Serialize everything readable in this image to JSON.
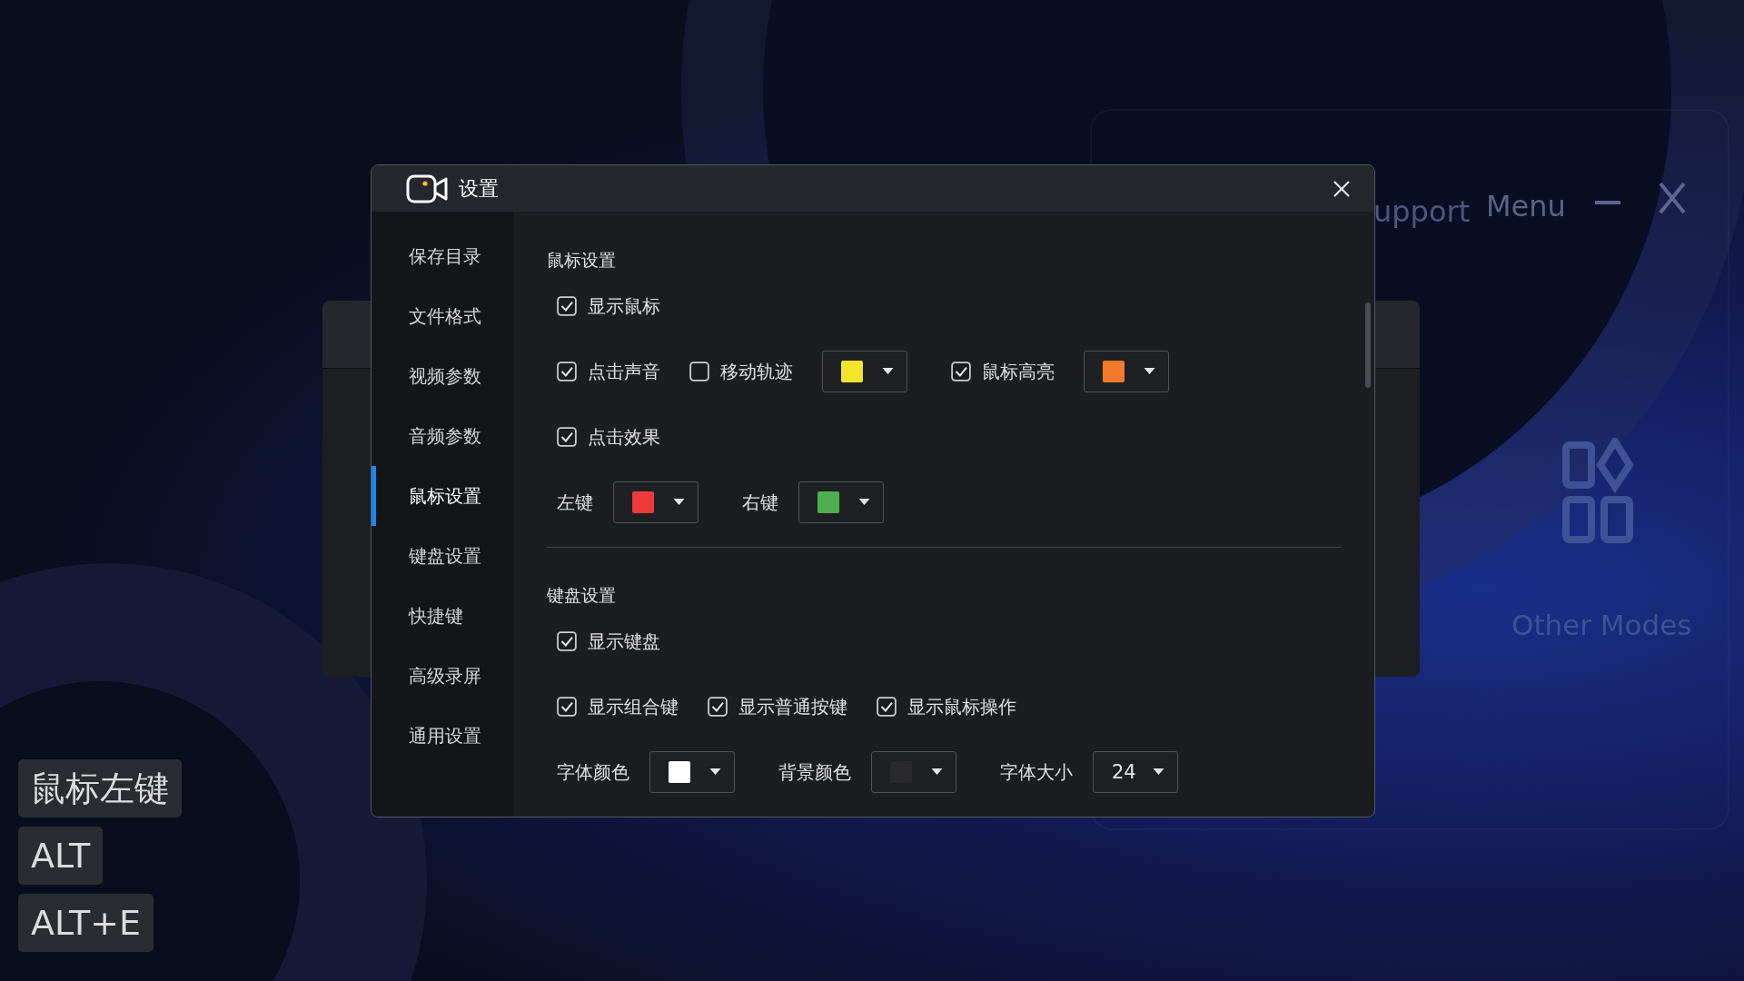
{
  "background": {
    "top_bar": {
      "support_label": "upport",
      "menu_label": "Menu"
    },
    "other_modes": {
      "label": "Other Modes"
    }
  },
  "key_overlay": [
    {
      "label": "鼠标左键"
    },
    {
      "label": "ALT"
    },
    {
      "label": "ALT+E"
    }
  ],
  "dialog": {
    "title": "设置",
    "sidebar": [
      {
        "label": "保存目录",
        "selected": false
      },
      {
        "label": "文件格式",
        "selected": false
      },
      {
        "label": "视频参数",
        "selected": false
      },
      {
        "label": "音频参数",
        "selected": false
      },
      {
        "label": "鼠标设置",
        "selected": true
      },
      {
        "label": "键盘设置",
        "selected": false
      },
      {
        "label": "快捷键",
        "selected": false
      },
      {
        "label": "高级录屏",
        "selected": false
      },
      {
        "label": "通用设置",
        "selected": false
      }
    ],
    "sections": [
      {
        "heading": "鼠标设置",
        "rows": [
          {
            "items": [
              {
                "kind": "checkbox",
                "label": "显示鼠标",
                "checked": true
              }
            ]
          },
          {
            "items": [
              {
                "kind": "checkbox",
                "label": "点击声音",
                "checked": true
              },
              {
                "kind": "checkbox",
                "label": "移动轨迹",
                "checked": false
              },
              {
                "kind": "color",
                "color": "#f2e52c"
              },
              {
                "kind": "checkbox",
                "label": "鼠标高亮",
                "checked": true
              },
              {
                "kind": "color",
                "color": "#f47a2b"
              }
            ]
          },
          {
            "items": [
              {
                "kind": "checkbox",
                "label": "点击效果",
                "checked": true
              }
            ]
          },
          {
            "items": [
              {
                "kind": "label",
                "label": "左键"
              },
              {
                "kind": "color",
                "color": "#ee3a3a"
              },
              {
                "kind": "label",
                "label": "右键"
              },
              {
                "kind": "color",
                "color": "#4caf50"
              }
            ]
          }
        ]
      },
      {
        "heading": "键盘设置",
        "rows": [
          {
            "items": [
              {
                "kind": "checkbox",
                "label": "显示键盘",
                "checked": true
              }
            ]
          },
          {
            "items": [
              {
                "kind": "checkbox",
                "label": "显示组合键",
                "checked": true
              },
              {
                "kind": "checkbox",
                "label": "显示普通按键",
                "checked": true
              },
              {
                "kind": "checkbox",
                "label": "显示鼠标操作",
                "checked": true
              }
            ]
          },
          {
            "items": [
              {
                "kind": "label",
                "label": "字体颜色"
              },
              {
                "kind": "color",
                "color": "#ffffff"
              },
              {
                "kind": "label",
                "label": "背景颜色"
              },
              {
                "kind": "color",
                "color": "#2a2a2c"
              },
              {
                "kind": "label",
                "label": "字体大小"
              },
              {
                "kind": "select",
                "value": "24"
              }
            ]
          }
        ]
      }
    ]
  }
}
